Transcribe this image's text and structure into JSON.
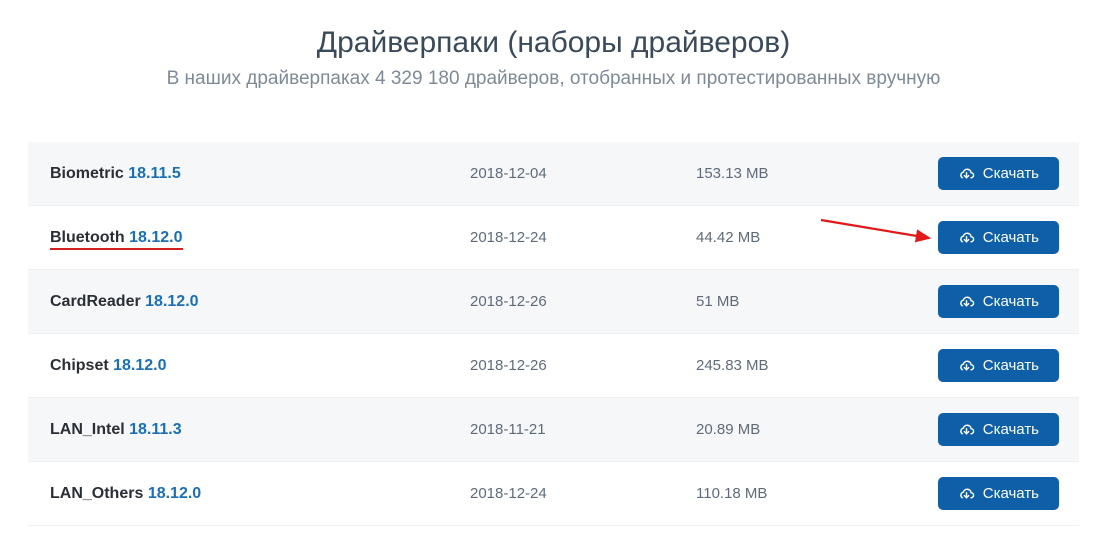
{
  "header": {
    "title": "Драйверпаки (наборы драйверов)",
    "subtitle": "В наших драйверпаках 4 329 180 драйверов, отобранных и протестированных вручную"
  },
  "download_label": "Скачать",
  "rows": [
    {
      "name": "Biometric",
      "version": "18.11.5",
      "date": "2018-12-04",
      "size": "153.13 MB",
      "alt": true,
      "highlight": false
    },
    {
      "name": "Bluetooth",
      "version": "18.12.0",
      "date": "2018-12-24",
      "size": "44.42 MB",
      "alt": false,
      "highlight": true
    },
    {
      "name": "CardReader",
      "version": "18.12.0",
      "date": "2018-12-26",
      "size": "51 MB",
      "alt": true,
      "highlight": false
    },
    {
      "name": "Chipset",
      "version": "18.12.0",
      "date": "2018-12-26",
      "size": "245.83 MB",
      "alt": false,
      "highlight": false
    },
    {
      "name": "LAN_Intel",
      "version": "18.11.3",
      "date": "2018-11-21",
      "size": "20.89 MB",
      "alt": true,
      "highlight": false
    },
    {
      "name": "LAN_Others",
      "version": "18.12.0",
      "date": "2018-12-24",
      "size": "110.18 MB",
      "alt": false,
      "highlight": false
    }
  ],
  "colors": {
    "accent": "#0f5fa8",
    "link": "#1a6fb5",
    "arrow": "#e11919"
  }
}
